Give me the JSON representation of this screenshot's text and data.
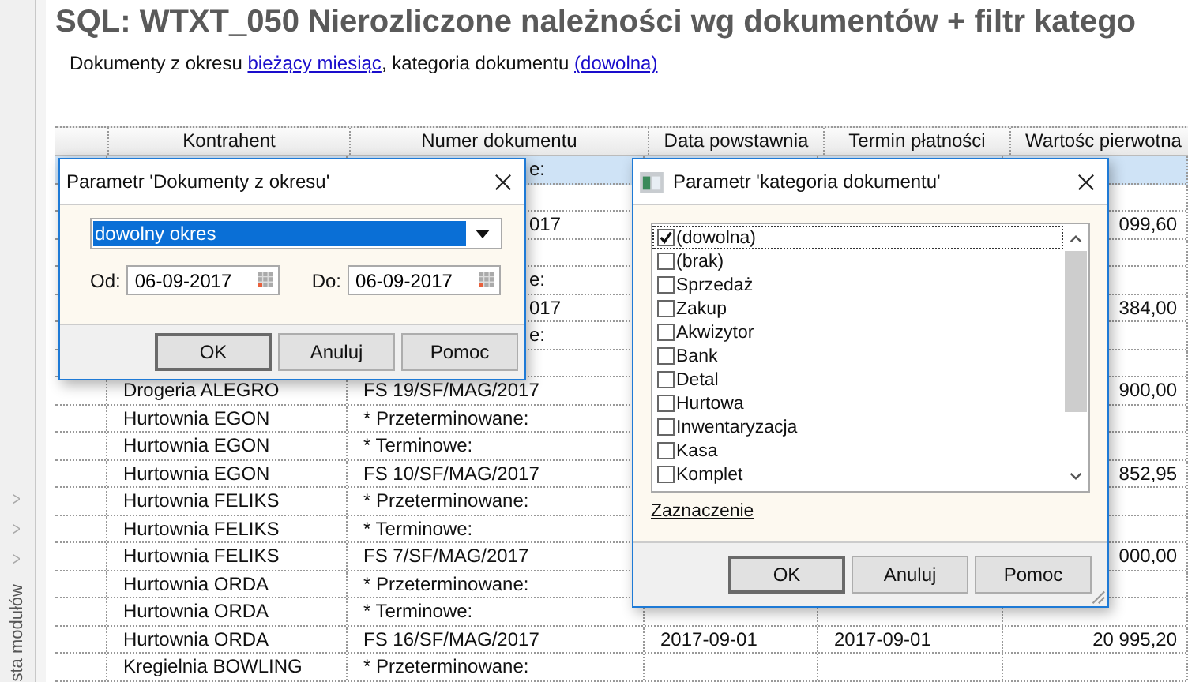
{
  "sidebar": {
    "label": "sta modułów",
    "chevrons": [
      ">",
      ">",
      ">"
    ]
  },
  "title": "SQL: WTXT_050 Nierozliczone należności wg dokumentów + filtr katego",
  "subtitle": {
    "text_1": "Dokumenty z okresu",
    "link_1": "bieżący miesiąc",
    "text_2": ", kategoria dokumentu",
    "link_2": "(dowolna)"
  },
  "table": {
    "columns": [
      "Kontrahent",
      "Numer dokumentu",
      "Data powstawnia",
      "Termin płatności",
      "Wartośc pierwotna"
    ],
    "rows": [
      {
        "numer": "e:",
        "partial": true,
        "selected": true
      },
      {
        "selected": false
      },
      {
        "numer": "017",
        "partial": true,
        "wartosc": "099,60",
        "selected": false
      },
      {
        "selected": false
      },
      {
        "numer": "e:",
        "partial": true,
        "selected": false
      },
      {
        "numer": "017",
        "partial": true,
        "wartosc": "384,00",
        "selected": false
      },
      {
        "numer": "e:",
        "partial": true,
        "selected": false
      },
      {
        "selected": false
      },
      {
        "kontrahent": "Drogeria ALEGRO",
        "numer": "FS 19/SF/MAG/2017",
        "partial": false,
        "wartosc": "900,00",
        "selected": false
      },
      {
        "kontrahent": "Hurtownia EGON",
        "numer": "* Przeterminowane:",
        "partial": false,
        "selected": false
      },
      {
        "kontrahent": "Hurtownia EGON",
        "numer": "* Terminowe:",
        "partial": false,
        "selected": false
      },
      {
        "kontrahent": "Hurtownia EGON",
        "numer": "FS 10/SF/MAG/2017",
        "partial": false,
        "wartosc": "852,95",
        "selected": false
      },
      {
        "kontrahent": "Hurtownia FELIKS",
        "numer": "* Przeterminowane:",
        "partial": false,
        "selected": false
      },
      {
        "kontrahent": "Hurtownia FELIKS",
        "numer": "* Terminowe:",
        "partial": false,
        "selected": false
      },
      {
        "kontrahent": "Hurtownia FELIKS",
        "numer": "FS 7/SF/MAG/2017",
        "partial": false,
        "wartosc": "000,00",
        "selected": false
      },
      {
        "kontrahent": "Hurtownia ORDA",
        "numer": "* Przeterminowane:",
        "partial": false,
        "selected": false
      },
      {
        "kontrahent": "Hurtownia ORDA",
        "numer": "* Terminowe:",
        "partial": false,
        "selected": false
      },
      {
        "kontrahent": "Hurtownia ORDA",
        "numer": "FS 16/SF/MAG/2017",
        "partial": false,
        "data": "2017-09-01",
        "termin": "2017-09-01",
        "wartosc": "20 995,20",
        "selected": false
      },
      {
        "kontrahent": "Kregielnia BOWLING",
        "numer": "* Przeterminowane:",
        "partial": false,
        "selected": false
      }
    ]
  },
  "dialog_period": {
    "title": "Parametr 'Dokumenty z okresu'",
    "period": "dowolny okres",
    "from_label": "Od:",
    "from": "06-09-2017",
    "to_label": "Do:",
    "to": "06-09-2017",
    "buttons": [
      "OK",
      "Anuluj",
      "Pomoc"
    ]
  },
  "dialog_category": {
    "title": "Parametr 'kategoria dokumentu'",
    "items": [
      {
        "label": "(dowolna)",
        "checked": true,
        "selected": true
      },
      {
        "label": "(brak)",
        "checked": false,
        "selected": false
      },
      {
        "label": "Sprzedaż",
        "checked": false,
        "selected": false
      },
      {
        "label": "Zakup",
        "checked": false,
        "selected": false
      },
      {
        "label": "Akwizytor",
        "checked": false,
        "selected": false
      },
      {
        "label": "Bank",
        "checked": false,
        "selected": false
      },
      {
        "label": "Detal",
        "checked": false,
        "selected": false
      },
      {
        "label": "Hurtowa",
        "checked": false,
        "selected": false
      },
      {
        "label": "Inwentaryzacja",
        "checked": false,
        "selected": false
      },
      {
        "label": "Kasa",
        "checked": false,
        "selected": false
      },
      {
        "label": "Komplet",
        "checked": false,
        "selected": false
      }
    ],
    "link": "Zaznaczenie",
    "buttons": [
      "OK",
      "Anuluj",
      "Pomoc"
    ]
  }
}
